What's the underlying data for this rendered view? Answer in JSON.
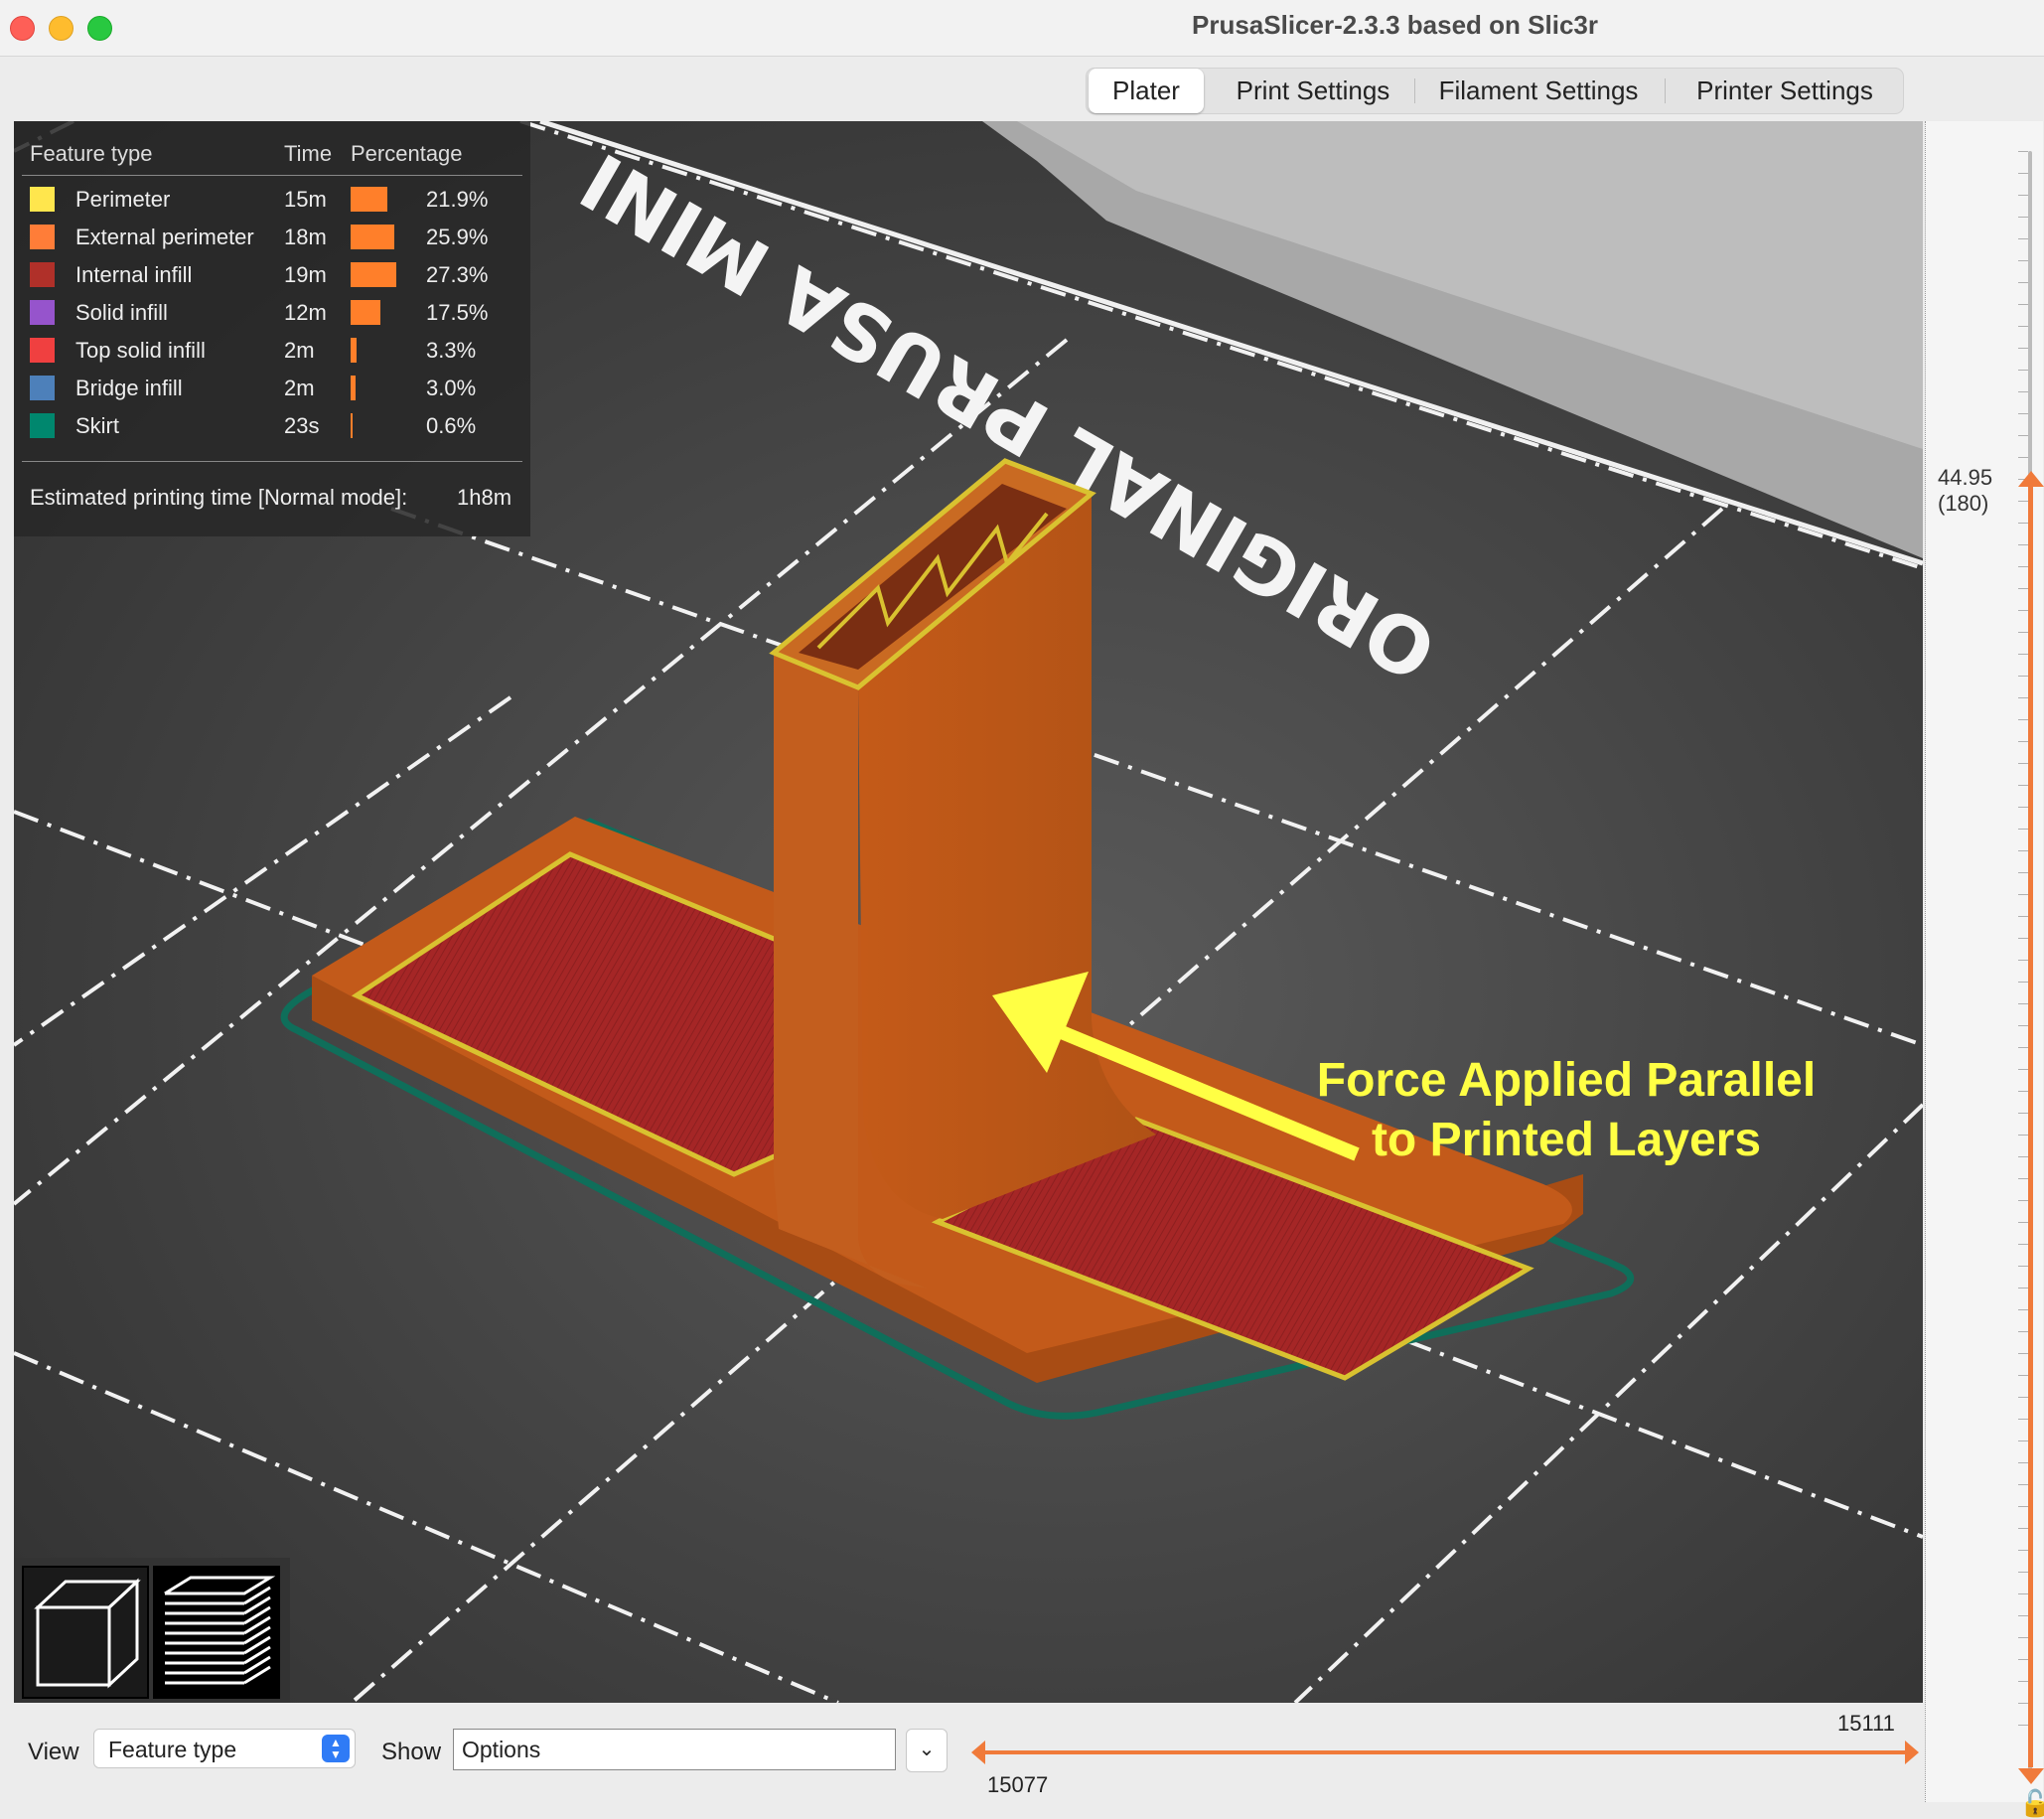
{
  "window": {
    "title": "PrusaSlicer-2.3.3 based on Slic3r"
  },
  "tabs": [
    {
      "label": "Plater",
      "active": true
    },
    {
      "label": "Print Settings",
      "active": false
    },
    {
      "label": "Filament Settings",
      "active": false
    },
    {
      "label": "Printer Settings",
      "active": false
    }
  ],
  "bed": {
    "logo_text": "ORIGINAL PRUSA MINI"
  },
  "legend": {
    "headers": {
      "feature": "Feature type",
      "time": "Time",
      "percentage": "Percentage"
    },
    "rows": [
      {
        "name": "Perimeter",
        "time": "15m",
        "percentage": "21.9%",
        "value": 21.9,
        "color": "#ffe64d"
      },
      {
        "name": "External perimeter",
        "time": "18m",
        "percentage": "25.9%",
        "value": 25.9,
        "color": "#ff7d38"
      },
      {
        "name": "Internal infill",
        "time": "19m",
        "percentage": "27.3%",
        "value": 27.3,
        "color": "#b03029"
      },
      {
        "name": "Solid infill",
        "time": "12m",
        "percentage": "17.5%",
        "value": 17.5,
        "color": "#9654cc"
      },
      {
        "name": "Top solid infill",
        "time": "2m",
        "percentage": "3.3%",
        "value": 3.3,
        "color": "#f04040"
      },
      {
        "name": "Bridge infill",
        "time": "2m",
        "percentage": "3.0%",
        "value": 3.0,
        "color": "#4d80ba"
      },
      {
        "name": "Skirt",
        "time": "23s",
        "percentage": "0.6%",
        "value": 0.6,
        "color": "#00876e"
      }
    ],
    "estimated_label": "Estimated printing time [Normal mode]:",
    "estimated_value": "1h8m"
  },
  "annotation": {
    "line1": "Force Applied Parallel",
    "line2": "to Printed Layers",
    "color": "#ffff44"
  },
  "vertical_slider": {
    "height_value": "44.95",
    "layer_value": "(180)"
  },
  "bottom_bar": {
    "view_label": "View",
    "view_value": "Feature type",
    "show_label": "Show",
    "show_value": "Options"
  },
  "horizontal_slider": {
    "upper_value": "15111",
    "lower_value": "15077"
  },
  "colors": {
    "accent_slider": "#f07a3a",
    "model_orange": "#c8601e",
    "infill_red": "#a82828",
    "skirt": "#0f6e5a"
  }
}
